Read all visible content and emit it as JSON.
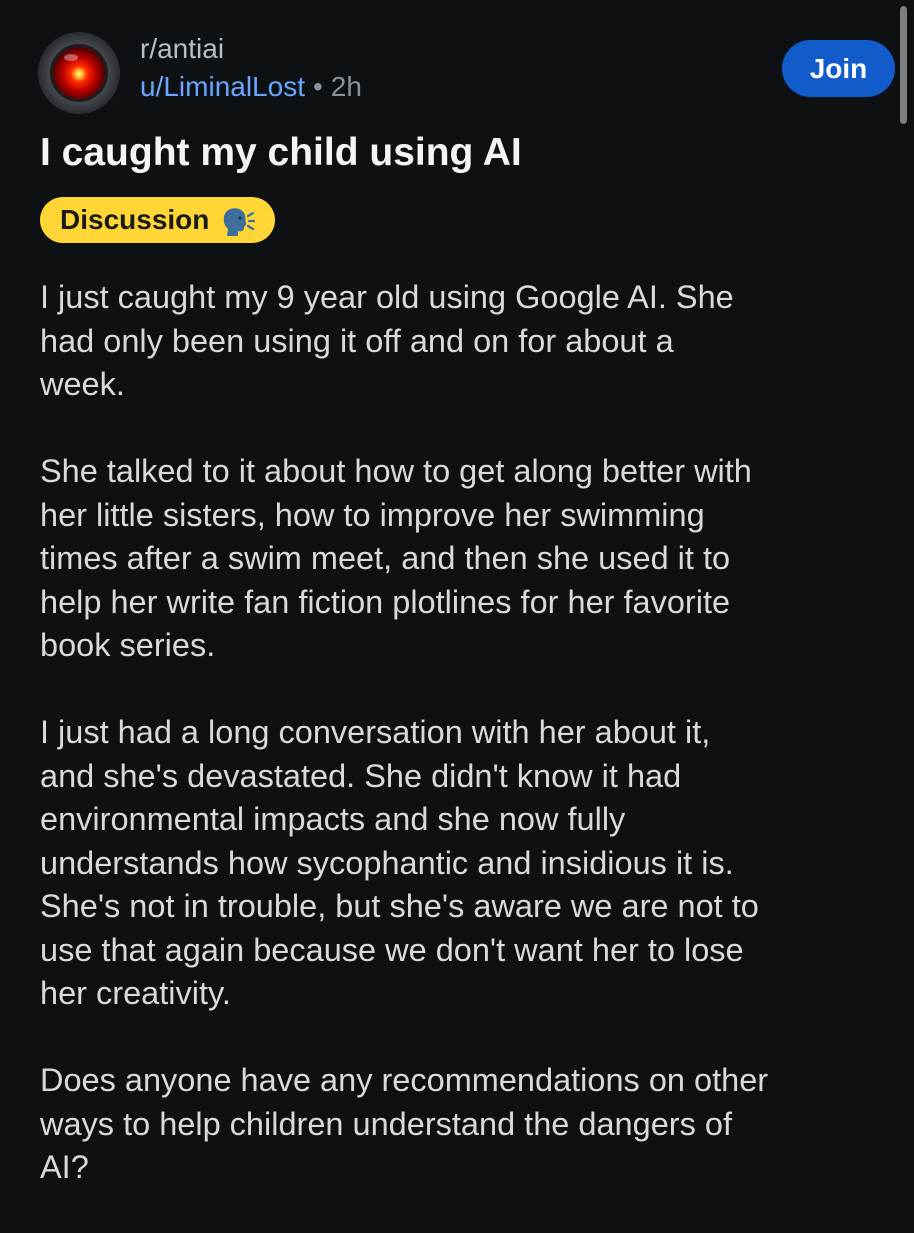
{
  "header": {
    "subreddit": "r/antiai",
    "username": "u/LiminalLost",
    "separator": "•",
    "time_ago": "2h",
    "join_label": "Join"
  },
  "post": {
    "title": "I caught my child using AI",
    "flair": {
      "label": "Discussion",
      "icon": "speaking-head-icon",
      "color": "#ffd635"
    },
    "paragraphs": [
      [
        "I just caught my 9 year old using Google AI. She",
        "had only been using it off and on for about a",
        "week."
      ],
      [
        "She talked to it about how to get along better with",
        "her little sisters, how to improve her swimming",
        "times after a swim meet, and then she used it to",
        "help her write fan fiction plotlines for her favorite",
        "book series."
      ],
      [
        "I just had a long conversation with her about it,",
        "and she's devastated. She didn't know it had",
        "environmental impacts and she now fully",
        "understands how sycophantic and insidious it is.",
        "She's not in trouble, but she's aware we are not to",
        "use that again because we don't want her to lose",
        "her creativity."
      ],
      [
        "Does anyone have any recommendations on other",
        "ways to help children understand the dangers of",
        "AI?"
      ]
    ]
  },
  "colors": {
    "background": "#0e1113",
    "accent": "#115bca",
    "username": "#6aa6ff"
  }
}
